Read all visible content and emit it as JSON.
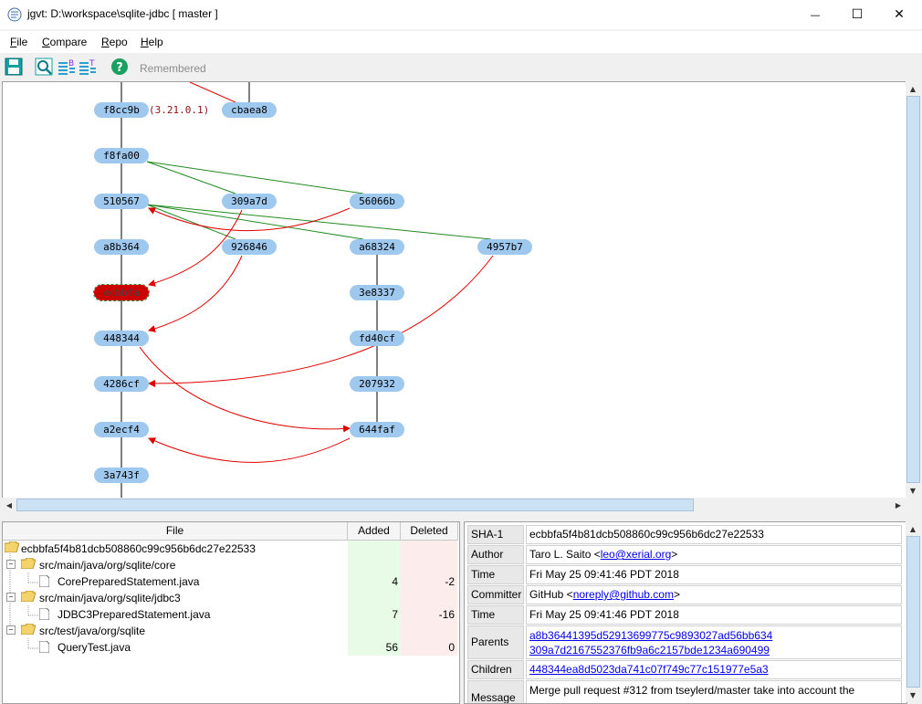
{
  "window": {
    "title": "jgvt: D:\\workspace\\sqlite-jdbc [ master ]",
    "minimize_glyph": "—",
    "maximize_glyph": "☐",
    "close_glyph": "✕"
  },
  "menu": {
    "items": [
      {
        "label": "File",
        "mnemonic": "F"
      },
      {
        "label": "Compare",
        "mnemonic": "C"
      },
      {
        "label": "Repo",
        "mnemonic": "R"
      },
      {
        "label": "Help",
        "mnemonic": "H"
      }
    ]
  },
  "toolbar": {
    "icons": [
      "save-icon",
      "search-icon",
      "branch-list-icon",
      "tag-list-icon",
      "help-icon"
    ],
    "remembered_label": "Remembered",
    "help_glyph": "?"
  },
  "graph": {
    "commits": [
      {
        "id": "f8cc9b",
        "tag": "(3.21.0.1)"
      },
      {
        "id": "cbaea8"
      },
      {
        "id": "f8fa00"
      },
      {
        "id": "510567"
      },
      {
        "id": "309a7d"
      },
      {
        "id": "56066b"
      },
      {
        "id": "a8b364"
      },
      {
        "id": "926846"
      },
      {
        "id": "a68324"
      },
      {
        "id": "4957b7"
      },
      {
        "id": "ecbbfa",
        "selected": true
      },
      {
        "id": "3e8337"
      },
      {
        "id": "448344"
      },
      {
        "id": "fd40cf"
      },
      {
        "id": "4286cf"
      },
      {
        "id": "207932"
      },
      {
        "id": "a2ecf4"
      },
      {
        "id": "644faf"
      },
      {
        "id": "3a743f"
      }
    ],
    "colors": {
      "node": "#9fc8ee",
      "selected": "#cc0000",
      "merge_edge": "#228b22",
      "cross_edge": "#ff0000",
      "branch_line": "#000000"
    }
  },
  "files": {
    "columns": [
      "File",
      "Added",
      "Deleted"
    ],
    "rows": [
      {
        "name": "ecbbfa5f4b81dcb508860c99c956b6dc27e22533",
        "kind": "commit",
        "added": "",
        "deleted": ""
      },
      {
        "name": "src/main/java/org/sqlite/core",
        "kind": "folder",
        "added": "",
        "deleted": ""
      },
      {
        "name": "CorePreparedStatement.java",
        "kind": "file",
        "added": "4",
        "deleted": "-2"
      },
      {
        "name": "src/main/java/org/sqlite/jdbc3",
        "kind": "folder",
        "added": "",
        "deleted": ""
      },
      {
        "name": "JDBC3PreparedStatement.java",
        "kind": "file",
        "added": "7",
        "deleted": "-16"
      },
      {
        "name": "src/test/java/org/sqlite",
        "kind": "folder",
        "added": "",
        "deleted": ""
      },
      {
        "name": "QueryTest.java",
        "kind": "file",
        "added": "56",
        "deleted": "0"
      }
    ]
  },
  "details": {
    "sha_label": "SHA-1",
    "sha": "ecbbfa5f4b81dcb508860c99c956b6dc27e22533",
    "author_label": "Author",
    "author_name": "Taro L. Saito <",
    "author_email": "leo@xerial.org",
    "author_close": ">",
    "time_label": "Time",
    "author_time": "Fri May 25 09:41:46 PDT 2018",
    "committer_label": "Committer",
    "committer_name": "GitHub <",
    "committer_email": "noreply@github.com",
    "committer_close": ">",
    "commit_time": "Fri May 25 09:41:46 PDT 2018",
    "parents_label": "Parents",
    "parents": [
      "a8b36441395d52913699775c9893027ad56bb634",
      "309a7d2167552376fb9a6c2157bde1234a690499"
    ],
    "children_label": "Children",
    "children": [
      "448344ea8d5023da741c07f749c77c151977e5a3"
    ],
    "message_label": "Message",
    "message": "Merge pull request #312 from tseylerd/master take into account the"
  }
}
